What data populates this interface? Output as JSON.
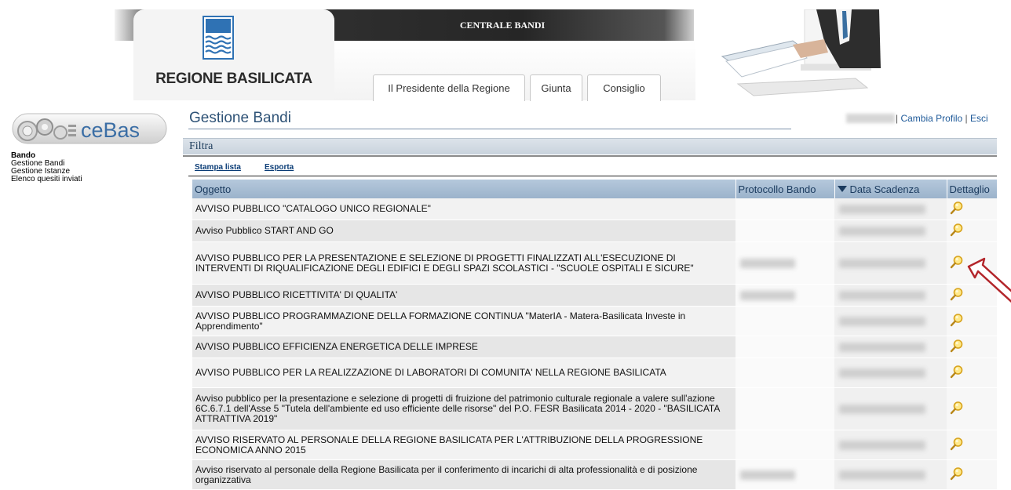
{
  "header": {
    "region_name": "REGIONE BASILICATA",
    "centrale_title": "CENTRALE BANDI",
    "tabs": [
      {
        "label": "Il Presidente della Regione"
      },
      {
        "label": "Giunta"
      },
      {
        "label": "Consiglio"
      }
    ]
  },
  "sidebar": {
    "logo_text": "ceBas",
    "menu_heading": "Bando",
    "items": [
      {
        "label": "Gestione Bandi"
      },
      {
        "label": "Gestione Istanze"
      },
      {
        "label": "Elenco quesiti inviati"
      }
    ]
  },
  "page": {
    "title": "Gestione Bandi",
    "user_links": {
      "separator": "|",
      "cambia_profilo": "Cambia Profilo",
      "esci": "Esci"
    },
    "filter_label": "Filtra",
    "toolbar": {
      "stampa": "Stampa lista",
      "esporta": "Esporta"
    }
  },
  "table": {
    "columns": {
      "oggetto": "Oggetto",
      "protocollo": "Protocollo Bando",
      "scadenza": "Data Scadenza",
      "dettaglio": "Dettaglio"
    },
    "rows": [
      {
        "oggetto": "AVVISO PUBBLICO \"CATALOGO UNICO REGIONALE\""
      },
      {
        "oggetto": "Avviso Pubblico START AND GO"
      },
      {
        "oggetto": "AVVISO PUBBLICO PER LA PRESENTAZIONE E SELEZIONE DI PROGETTI FINALIZZATI ALL'ESECUZIONE DI INTERVENTI DI RIQUALIFICAZIONE DEGLI EDIFICI E DEGLI SPAZI SCOLASTICI - \"SCUOLE OSPITALI E SICURE\""
      },
      {
        "oggetto": "AVVISO PUBBLICO RICETTIVITA' DI QUALITA'"
      },
      {
        "oggetto": "AVVISO PUBBLICO PROGRAMMAZIONE DELLA FORMAZIONE CONTINUA \"MaterIA - Matera-Basilicata Investe in Apprendimento\""
      },
      {
        "oggetto": "AVVISO PUBBLICO EFFICIENZA ENERGETICA DELLE IMPRESE"
      },
      {
        "oggetto": "AVVISO PUBBLICO PER LA REALIZZAZIONE DI LABORATORI DI COMUNITA' NELLA REGIONE BASILICATA"
      },
      {
        "oggetto": "Avviso pubblico per la presentazione e selezione di progetti di fruizione del patrimonio culturale regionale a valere sull'azione 6C.6.7.1 dell'Asse 5 \"Tutela dell'ambiente ed uso efficiente delle risorse\" del P.O. FESR Basilicata 2014 - 2020 - \"BASILICATA ATTRATTIVA 2019\""
      },
      {
        "oggetto": "AVVISO RISERVATO AL PERSONALE DELLA REGIONE BASILICATA PER L'ATTRIBUZIONE DELLA PROGRESSIONE ECONOMICA ANNO 2015"
      },
      {
        "oggetto": "Avviso riservato al personale della Regione Basilicata per il conferimento di incarichi di alta professionalità e di posizione organizzativa"
      }
    ]
  },
  "colors": {
    "title": "#2f5377",
    "header_band": "#2f2f2f",
    "table_header": "#a9bdd3",
    "link": "#1f5a99",
    "annotation_arrow": "#b3262b"
  },
  "icons": {
    "detail": "magnifier-icon",
    "sort": "sort-down-icon"
  }
}
